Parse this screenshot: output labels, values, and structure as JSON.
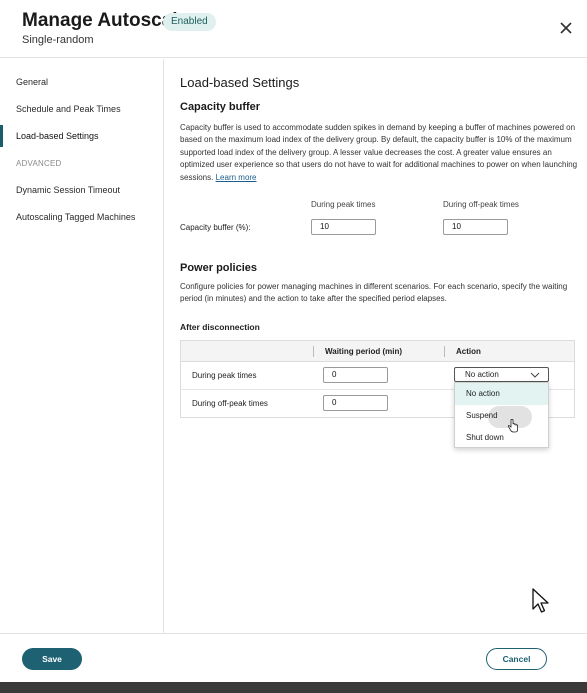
{
  "header": {
    "title": "Manage Autoscale",
    "badge": "Enabled",
    "subtitle": "Single-random",
    "close_icon": "close-icon"
  },
  "sidebar": {
    "items": [
      {
        "label": "General"
      },
      {
        "label": "Schedule and Peak Times"
      },
      {
        "label": "Load-based Settings",
        "active": true
      }
    ],
    "section_label": "ADVANCED",
    "advanced_items": [
      {
        "label": "Dynamic Session Timeout"
      },
      {
        "label": "Autoscaling Tagged Machines"
      }
    ]
  },
  "main": {
    "heading": "Load-based Settings",
    "capacity": {
      "title": "Capacity buffer",
      "description": "Capacity buffer is used to accommodate sudden spikes in demand by keeping a buffer of machines powered on based on the maximum load index of the delivery group. By default, the capacity buffer is 10% of the maximum supported load index of the delivery group. A lesser value decreases the cost. A greater value ensures an optimized user experience so that users do not have to wait for additional machines to power on when launching sessions.",
      "learn_more": "Learn more",
      "col_peak": "During peak times",
      "col_offpeak": "During off-peak times",
      "row_label": "Capacity buffer (%):",
      "peak_value": "10",
      "offpeak_value": "10"
    },
    "power": {
      "title": "Power policies",
      "description": "Configure policies for power managing machines in different scenarios. For each scenario, specify the waiting period (in minutes) and the action to take after the specified period elapses.",
      "subheading": "After disconnection",
      "table": {
        "headers": [
          "",
          "Waiting period (min)",
          "Action"
        ],
        "rows": [
          {
            "label": "During peak times",
            "wait": "0",
            "action": "No action"
          },
          {
            "label": "During off-peak times",
            "wait": "0"
          }
        ]
      },
      "dropdown_options": [
        "No action",
        "Suspend",
        "Shut down"
      ]
    }
  },
  "footer": {
    "save": "Save",
    "cancel": "Cancel"
  },
  "colors": {
    "accent": "#1d6173",
    "badge_bg": "#dff0ee",
    "selected_option_bg": "#e2f3f2"
  }
}
